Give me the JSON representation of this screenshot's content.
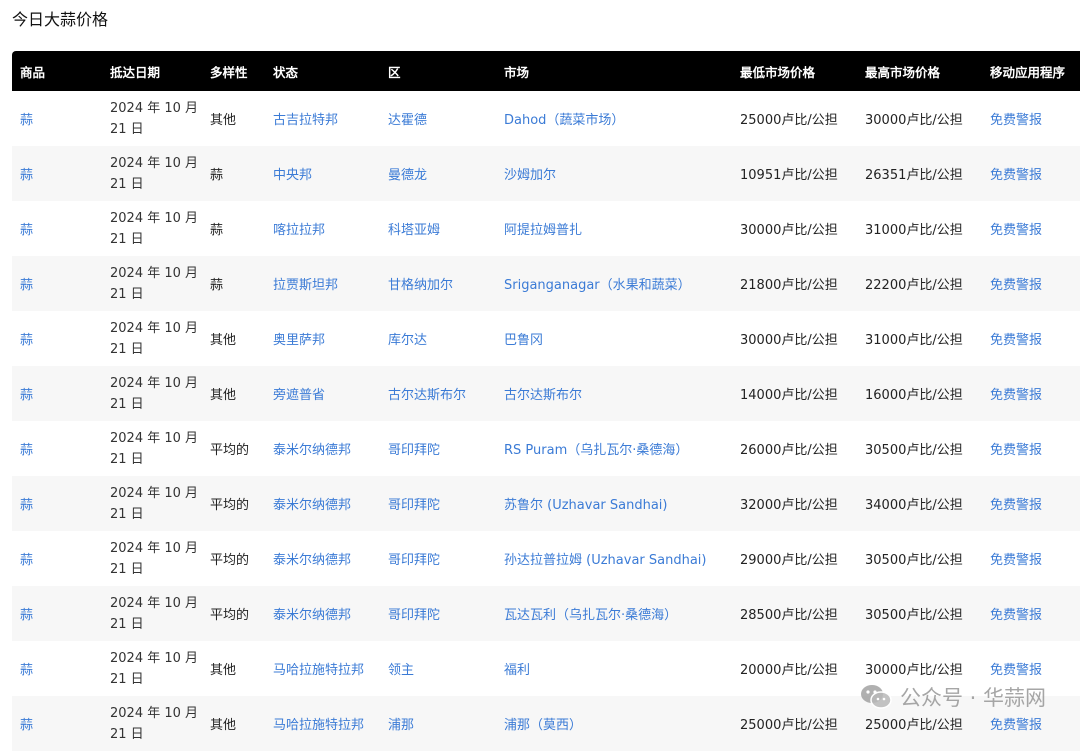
{
  "title": "今日大蒜价格",
  "columns": [
    "商品",
    "抵达日期",
    "多样性",
    "状态",
    "区",
    "市场",
    "最低市场价格",
    "最高市场价格",
    "移动应用程序"
  ],
  "rows": [
    {
      "commodity": "蒜",
      "date": "2024 年 10 月 21 日",
      "variety": "其他",
      "state": "古吉拉特邦",
      "district": "达霍德",
      "market": "Dahod（蔬菜市场）",
      "min_price": "25000卢比/公担",
      "max_price": "30000卢比/公担",
      "app": "免费警报"
    },
    {
      "commodity": "蒜",
      "date": "2024 年 10 月 21 日",
      "variety": "蒜",
      "state": "中央邦",
      "district": "曼德龙",
      "market": "沙姆加尔",
      "min_price": "10951卢比/公担",
      "max_price": "26351卢比/公担",
      "app": "免费警报"
    },
    {
      "commodity": "蒜",
      "date": "2024 年 10 月 21 日",
      "variety": "蒜",
      "state": "喀拉拉邦",
      "district": "科塔亚姆",
      "market": "阿提拉姆普扎",
      "min_price": "30000卢比/公担",
      "max_price": "31000卢比/公担",
      "app": "免费警报"
    },
    {
      "commodity": "蒜",
      "date": "2024 年 10 月 21 日",
      "variety": "蒜",
      "state": "拉贾斯坦邦",
      "district": "甘格纳加尔",
      "market": "Sriganganagar（水果和蔬菜）",
      "min_price": "21800卢比/公担",
      "max_price": "22200卢比/公担",
      "app": "免费警报"
    },
    {
      "commodity": "蒜",
      "date": "2024 年 10 月 21 日",
      "variety": "其他",
      "state": "奥里萨邦",
      "district": "库尔达",
      "market": "巴鲁冈",
      "min_price": "30000卢比/公担",
      "max_price": "31000卢比/公担",
      "app": "免费警报"
    },
    {
      "commodity": "蒜",
      "date": "2024 年 10 月 21 日",
      "variety": "其他",
      "state": "旁遮普省",
      "district": "古尔达斯布尔",
      "market": "古尔达斯布尔",
      "min_price": "14000卢比/公担",
      "max_price": "16000卢比/公担",
      "app": "免费警报"
    },
    {
      "commodity": "蒜",
      "date": "2024 年 10 月 21 日",
      "variety": "平均的",
      "state": "泰米尔纳德邦",
      "district": "哥印拜陀",
      "market": "RS Puram（乌扎瓦尔·桑德海）",
      "min_price": "26000卢比/公担",
      "max_price": "30500卢比/公担",
      "app": "免费警报"
    },
    {
      "commodity": "蒜",
      "date": "2024 年 10 月 21 日",
      "variety": "平均的",
      "state": "泰米尔纳德邦",
      "district": "哥印拜陀",
      "market": "苏鲁尔 (Uzhavar Sandhai)",
      "min_price": "32000卢比/公担",
      "max_price": "34000卢比/公担",
      "app": "免费警报"
    },
    {
      "commodity": "蒜",
      "date": "2024 年 10 月 21 日",
      "variety": "平均的",
      "state": "泰米尔纳德邦",
      "district": "哥印拜陀",
      "market": "孙达拉普拉姆 (Uzhavar Sandhai)",
      "min_price": "29000卢比/公担",
      "max_price": "30500卢比/公担",
      "app": "免费警报"
    },
    {
      "commodity": "蒜",
      "date": "2024 年 10 月 21 日",
      "variety": "平均的",
      "state": "泰米尔纳德邦",
      "district": "哥印拜陀",
      "market": "瓦达瓦利（乌扎瓦尔·桑德海）",
      "min_price": "28500卢比/公担",
      "max_price": "30500卢比/公担",
      "app": "免费警报"
    },
    {
      "commodity": "蒜",
      "date": "2024 年 10 月 21 日",
      "variety": "其他",
      "state": "马哈拉施特拉邦",
      "district": "领主",
      "market": "福利",
      "min_price": "20000卢比/公担",
      "max_price": "30000卢比/公担",
      "app": "免费警报"
    },
    {
      "commodity": "蒜",
      "date": "2024 年 10 月 21 日",
      "variety": "其他",
      "state": "马哈拉施特拉邦",
      "district": "浦那",
      "market": "浦那（莫西）",
      "min_price": "25000卢比/公担",
      "max_price": "25000卢比/公担",
      "app": "免费警报"
    }
  ],
  "watermark": {
    "text": "公众号 · 华蒜网",
    "icon": "wechat-icon"
  },
  "colors": {
    "header_bg": "#000000",
    "link": "#3b7bd6",
    "stripe": "#f7f7f7"
  }
}
